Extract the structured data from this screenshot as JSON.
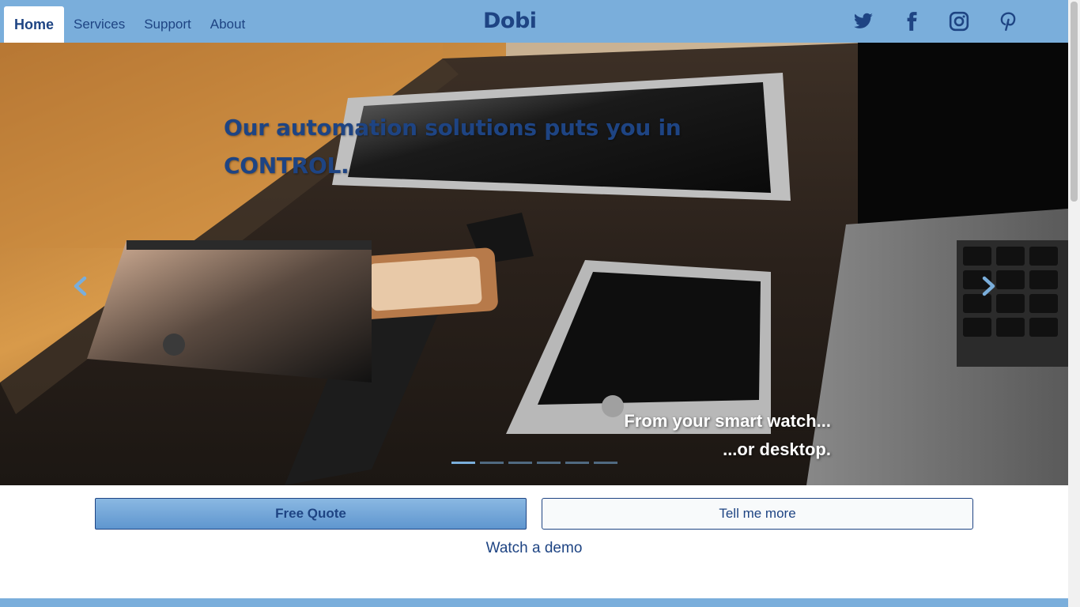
{
  "nav": {
    "links": [
      {
        "label": "Home",
        "active": true
      },
      {
        "label": "Services"
      },
      {
        "label": "Support"
      },
      {
        "label": "About"
      }
    ],
    "brand": "Dobi",
    "social": [
      "twitter-icon",
      "facebook-icon",
      "instagram-icon",
      "pinterest-icon"
    ]
  },
  "hero": {
    "headline": "Our automation solutions puts you in CONTROL.",
    "caption_line1": "From your smart watch...",
    "caption_line2": "...or desktop.",
    "indicator_count": 6,
    "active_indicator": 0
  },
  "cta": {
    "primary_label": "Free Quote",
    "secondary_label": "Tell me more",
    "demo_label": "Watch a demo"
  },
  "colors": {
    "nav_bg": "#7aaedb",
    "brand_blue": "#1e4483",
    "white": "#ffffff"
  }
}
